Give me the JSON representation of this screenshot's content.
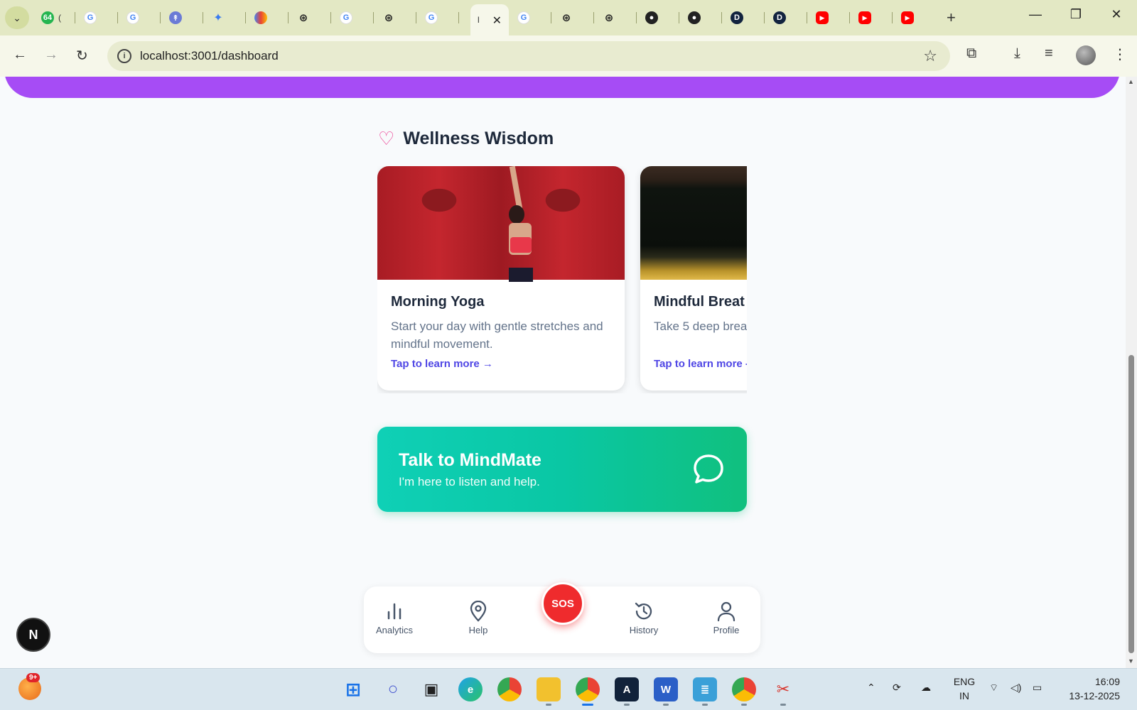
{
  "browser": {
    "tab_count_badge": "64",
    "active_tab_title": "l",
    "url": "localhost:3001/dashboard"
  },
  "page": {
    "section_title": "Wellness Wisdom",
    "cards": [
      {
        "title": "Morning Yoga",
        "description": "Start your day with gentle stretches and mindful movement.",
        "link": "Tap to learn more →"
      },
      {
        "title": "Mindful Breat",
        "description": "Take 5 deep brea and body.",
        "link": "Tap to learn more -"
      }
    ],
    "cta": {
      "title": "Talk to MindMate",
      "subtitle": "I'm here to listen and help."
    },
    "bottom_nav": [
      {
        "label": "Analytics",
        "icon": "bar-chart-icon"
      },
      {
        "label": "Help",
        "icon": "map-pin-icon"
      },
      {
        "label": "History",
        "icon": "history-icon"
      },
      {
        "label": "Profile",
        "icon": "user-icon"
      }
    ],
    "sos_label": "SOS",
    "dev_badge": "N"
  },
  "taskbar": {
    "weather_badge": "9+",
    "lang_line1": "ENG",
    "lang_line2": "IN",
    "time": "16:09",
    "date": "13-12-2025"
  },
  "colors": {
    "accent_purple": "#a64cf5",
    "cta_teal": "#0fd0b6",
    "cta_green": "#10c07e",
    "sos_red": "#ef2b2d",
    "link_indigo": "#4f46e5",
    "heart_pink": "#ec4899"
  }
}
